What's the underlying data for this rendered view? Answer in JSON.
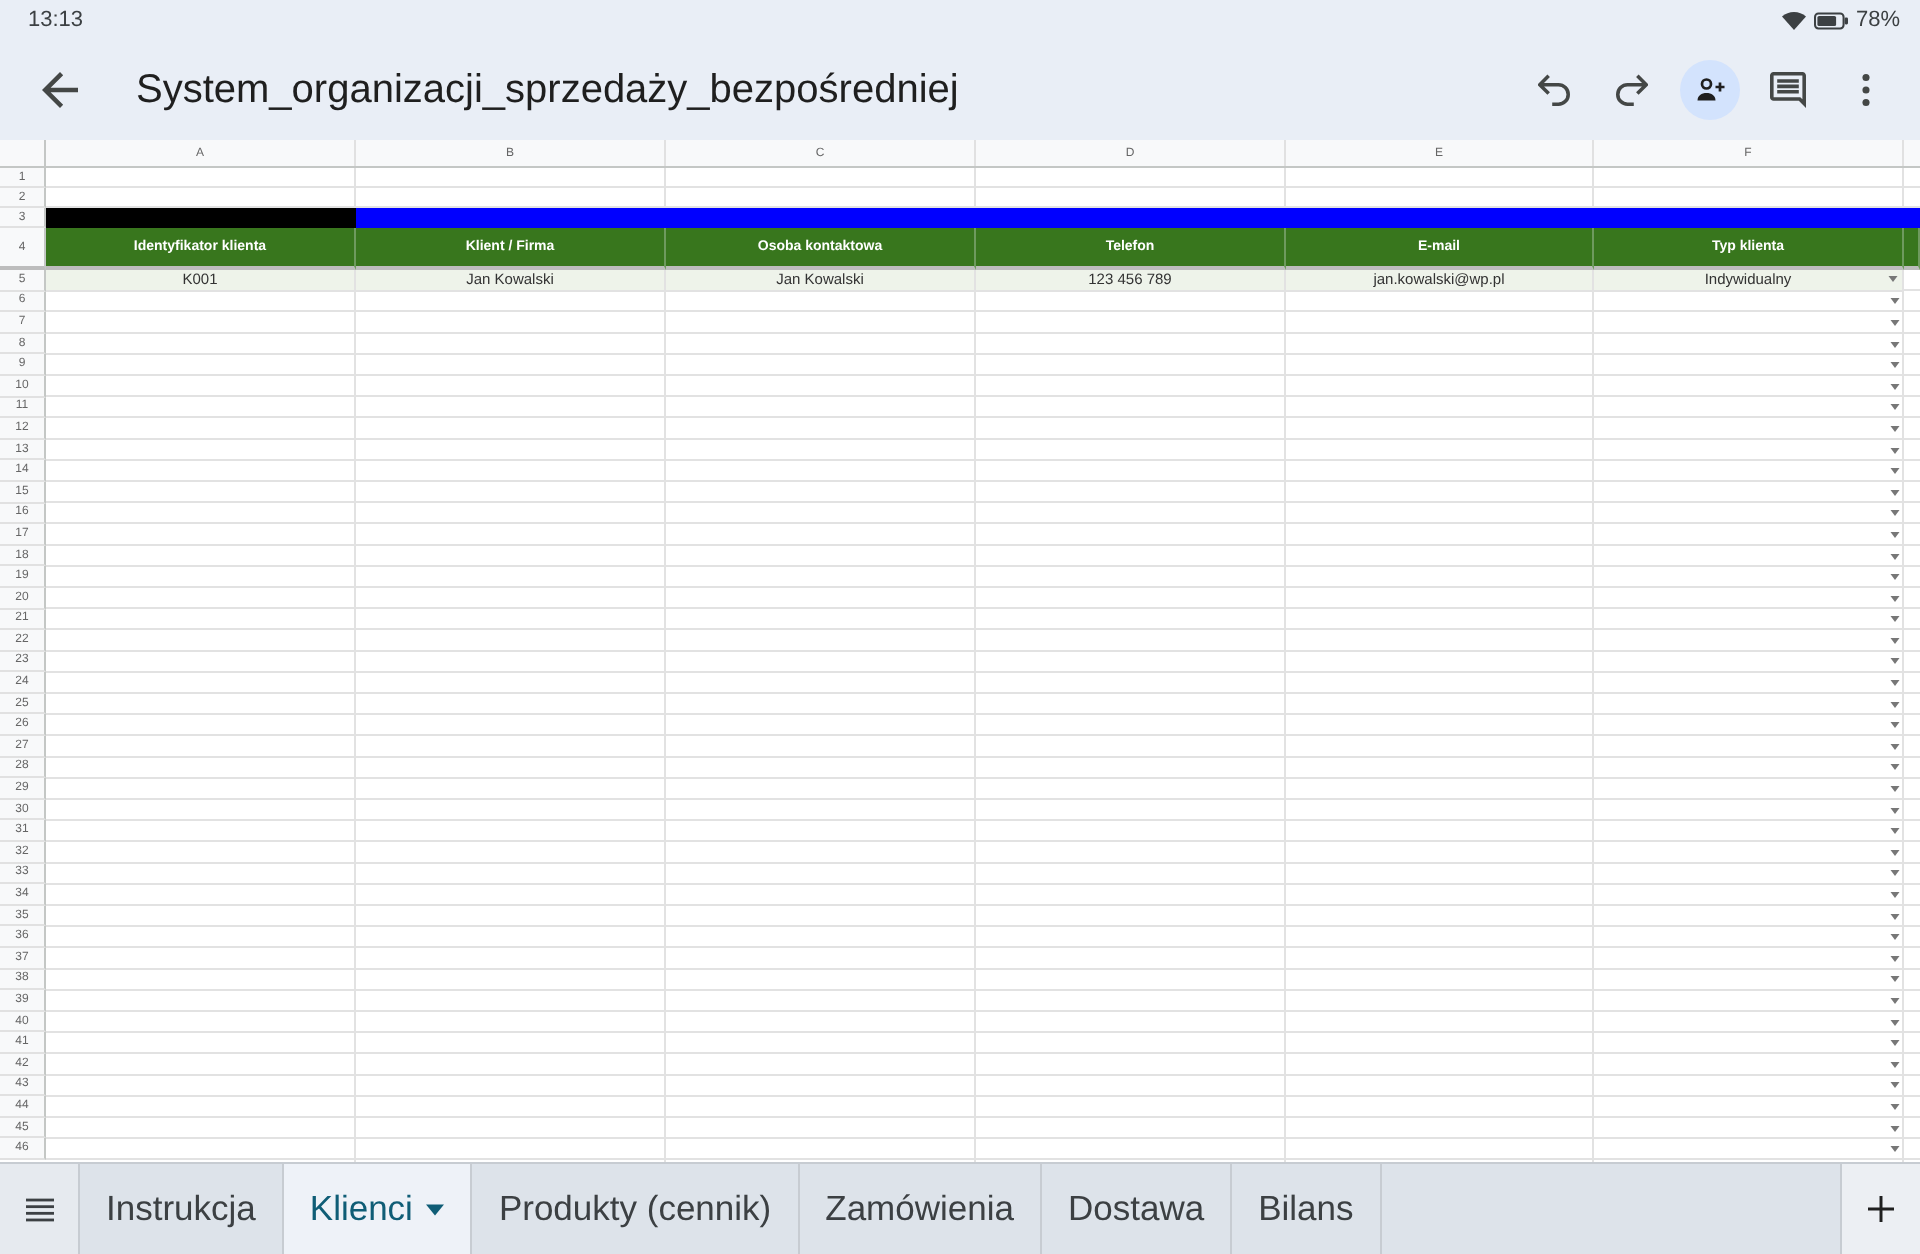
{
  "status_bar": {
    "time": "13:13",
    "battery": "78%"
  },
  "toolbar": {
    "title": "System_organizacji_sprzedaży_bezpośredniej"
  },
  "sheet": {
    "columns": [
      "A",
      "B",
      "C",
      "D",
      "E",
      "F"
    ],
    "rows": [
      {
        "number": "1",
        "kind": "blank"
      },
      {
        "number": "2",
        "kind": "blank"
      },
      {
        "number": "3",
        "kind": "band",
        "fills": [
          {
            "color": "#000000"
          },
          {
            "color": "#0000ff"
          },
          {
            "color": "#0000ff"
          },
          {
            "color": "#0000ff"
          },
          {
            "color": "#0000ff"
          },
          {
            "color": "#0000ff"
          },
          {
            "color": "#0000ff"
          }
        ]
      },
      {
        "number": "4",
        "kind": "header",
        "cells": [
          "Identyfikator klienta",
          "Klient / Firma",
          "Osoba kontaktowa",
          "Telefon",
          "E-mail",
          "Typ klienta"
        ]
      },
      {
        "number": "5",
        "kind": "data",
        "dropdown": true,
        "cells": [
          "K001",
          "Jan Kowalski",
          "Jan Kowalski",
          "123 456 789",
          "jan.kowalski@wp.pl",
          "Indywidualny"
        ]
      },
      {
        "number": "6",
        "kind": "data",
        "dropdown": true
      },
      {
        "number": "7",
        "kind": "data",
        "dropdown": true
      },
      {
        "number": "8",
        "kind": "data",
        "dropdown": true
      },
      {
        "number": "9",
        "kind": "data",
        "dropdown": true
      },
      {
        "number": "10",
        "kind": "data",
        "dropdown": true
      },
      {
        "number": "11",
        "kind": "data",
        "dropdown": true
      },
      {
        "number": "12",
        "kind": "data",
        "dropdown": true
      },
      {
        "number": "13",
        "kind": "data",
        "dropdown": true
      },
      {
        "number": "14",
        "kind": "data",
        "dropdown": true
      },
      {
        "number": "15",
        "kind": "data",
        "dropdown": true
      },
      {
        "number": "16",
        "kind": "data",
        "dropdown": true
      },
      {
        "number": "17",
        "kind": "data",
        "dropdown": true
      },
      {
        "number": "18",
        "kind": "data",
        "dropdown": true
      },
      {
        "number": "19",
        "kind": "data",
        "dropdown": true
      },
      {
        "number": "20",
        "kind": "data",
        "dropdown": true
      },
      {
        "number": "21",
        "kind": "data",
        "dropdown": true
      },
      {
        "number": "22",
        "kind": "data",
        "dropdown": true
      },
      {
        "number": "23",
        "kind": "data",
        "dropdown": true
      },
      {
        "number": "24",
        "kind": "data",
        "dropdown": true
      },
      {
        "number": "25",
        "kind": "data",
        "dropdown": true
      },
      {
        "number": "26",
        "kind": "data",
        "dropdown": true
      },
      {
        "number": "27",
        "kind": "data",
        "dropdown": true
      },
      {
        "number": "28",
        "kind": "data",
        "dropdown": true
      },
      {
        "number": "29",
        "kind": "data",
        "dropdown": true
      },
      {
        "number": "30",
        "kind": "data",
        "dropdown": true
      },
      {
        "number": "31",
        "kind": "data",
        "dropdown": true
      },
      {
        "number": "32",
        "kind": "data",
        "dropdown": true
      },
      {
        "number": "33",
        "kind": "data",
        "dropdown": true
      },
      {
        "number": "34",
        "kind": "data",
        "dropdown": true
      },
      {
        "number": "35",
        "kind": "data",
        "dropdown": true
      },
      {
        "number": "36",
        "kind": "data",
        "dropdown": true
      },
      {
        "number": "37",
        "kind": "data",
        "dropdown": true
      },
      {
        "number": "38",
        "kind": "data",
        "dropdown": true
      },
      {
        "number": "39",
        "kind": "data",
        "dropdown": true
      },
      {
        "number": "40",
        "kind": "data",
        "dropdown": true
      },
      {
        "number": "41",
        "kind": "data",
        "dropdown": true
      },
      {
        "number": "42",
        "kind": "data",
        "dropdown": true
      },
      {
        "number": "43",
        "kind": "data",
        "dropdown": true
      },
      {
        "number": "44",
        "kind": "data",
        "dropdown": true
      },
      {
        "number": "45",
        "kind": "data",
        "dropdown": true
      },
      {
        "number": "46",
        "kind": "data",
        "dropdown": true
      }
    ]
  },
  "tabs": [
    {
      "label": "Instrukcja",
      "selected": false
    },
    {
      "label": "Klienci",
      "selected": true
    },
    {
      "label": "Produkty (cennik)",
      "selected": false
    },
    {
      "label": "Zamówienia",
      "selected": false
    },
    {
      "label": "Dostawa",
      "selected": false
    },
    {
      "label": "Bilans",
      "selected": false
    }
  ]
}
